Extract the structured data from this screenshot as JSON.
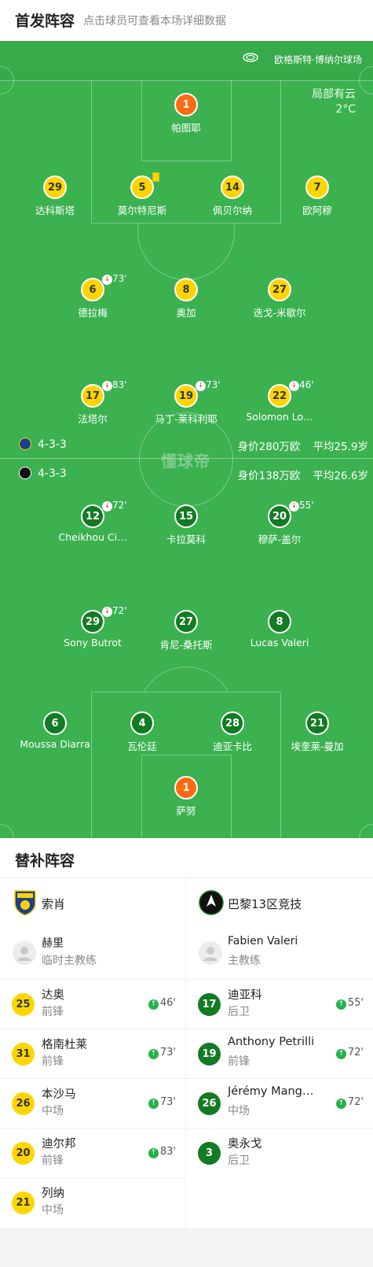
{
  "header": {
    "title": "首发阵容",
    "subtitle": "点击球员可查看本场详细数据"
  },
  "pitch": {
    "venue": "欧格斯特·博纳尔球场",
    "weather_desc": "局部有云",
    "weather_temp": "2°C",
    "watermark": "懂球帝"
  },
  "home": {
    "formation": "4-3-3",
    "value": "身价280万欧",
    "avg_age": "平均25.9岁",
    "color": "#ffd500",
    "players": [
      {
        "num": "1",
        "name": "帕图耶",
        "kind": "o",
        "sub": ""
      },
      {
        "num": "29",
        "name": "达科斯塔",
        "kind": "y",
        "sub": ""
      },
      {
        "num": "5",
        "name": "莫尔特尼斯",
        "kind": "y",
        "sub": "",
        "card": "yellow"
      },
      {
        "num": "14",
        "name": "佩贝尔纳",
        "kind": "y",
        "sub": ""
      },
      {
        "num": "7",
        "name": "欧阿穆",
        "kind": "y",
        "sub": ""
      },
      {
        "num": "6",
        "name": "德拉梅",
        "kind": "y",
        "sub": "73'"
      },
      {
        "num": "8",
        "name": "奥加",
        "kind": "y",
        "sub": ""
      },
      {
        "num": "27",
        "name": "迭戈-米歇尔",
        "kind": "y",
        "sub": ""
      },
      {
        "num": "17",
        "name": "法塔尔",
        "kind": "y",
        "sub": "83'"
      },
      {
        "num": "19",
        "name": "马丁-莱科利耶",
        "kind": "y",
        "sub": "73'"
      },
      {
        "num": "22",
        "name": "Solomon Lo…",
        "kind": "y",
        "sub": "46'"
      }
    ]
  },
  "away": {
    "formation": "4-3-3",
    "value": "身价138万欧",
    "avg_age": "平均26.6岁",
    "color": "#127b23",
    "players": [
      {
        "num": "12",
        "name": "Cheikhou Ci…",
        "kind": "g",
        "sub": "72'"
      },
      {
        "num": "15",
        "name": "卡拉莫科",
        "kind": "g",
        "sub": ""
      },
      {
        "num": "20",
        "name": "穆萨-盖尔",
        "kind": "g",
        "sub": "55'"
      },
      {
        "num": "29",
        "name": "Sony Butrot",
        "kind": "g",
        "sub": "72'"
      },
      {
        "num": "27",
        "name": "肯尼-桑托斯",
        "kind": "g",
        "sub": ""
      },
      {
        "num": "8",
        "name": "Lucas Valeri",
        "kind": "g",
        "sub": ""
      },
      {
        "num": "6",
        "name": "Moussa Diarra",
        "kind": "g",
        "sub": ""
      },
      {
        "num": "4",
        "name": "瓦伦廷",
        "kind": "g",
        "sub": ""
      },
      {
        "num": "28",
        "name": "迪亚卡比",
        "kind": "g",
        "sub": ""
      },
      {
        "num": "21",
        "name": "埃奎莱-曼加",
        "kind": "g",
        "sub": ""
      },
      {
        "num": "1",
        "name": "萨努",
        "kind": "o",
        "sub": ""
      }
    ]
  },
  "subs": {
    "title": "替补阵容",
    "left": {
      "team": "索肖",
      "coach_name": "赫里",
      "coach_role": "临时主教练",
      "rows": [
        {
          "num": "25",
          "name": "达奥",
          "pos": "前锋",
          "min": "46'"
        },
        {
          "num": "31",
          "name": "格南杜莱",
          "pos": "前锋",
          "min": "73'"
        },
        {
          "num": "26",
          "name": "本沙马",
          "pos": "中场",
          "min": "73'"
        },
        {
          "num": "20",
          "name": "迪尔邦",
          "pos": "前锋",
          "min": "83'"
        },
        {
          "num": "21",
          "name": "列纳",
          "pos": "中场",
          "min": ""
        }
      ]
    },
    "right": {
      "team": "巴黎13区竞技",
      "coach_name": "Fabien Valeri",
      "coach_role": "主教练",
      "rows": [
        {
          "num": "17",
          "name": "迪亚科",
          "pos": "后卫",
          "min": "55'"
        },
        {
          "num": "19",
          "name": "Anthony Petrilli",
          "pos": "前锋",
          "min": "72'"
        },
        {
          "num": "26",
          "name": "Jérémy Mang…",
          "pos": "中场",
          "min": "72'"
        },
        {
          "num": "3",
          "name": "奥永戈",
          "pos": "后卫",
          "min": ""
        }
      ]
    }
  }
}
